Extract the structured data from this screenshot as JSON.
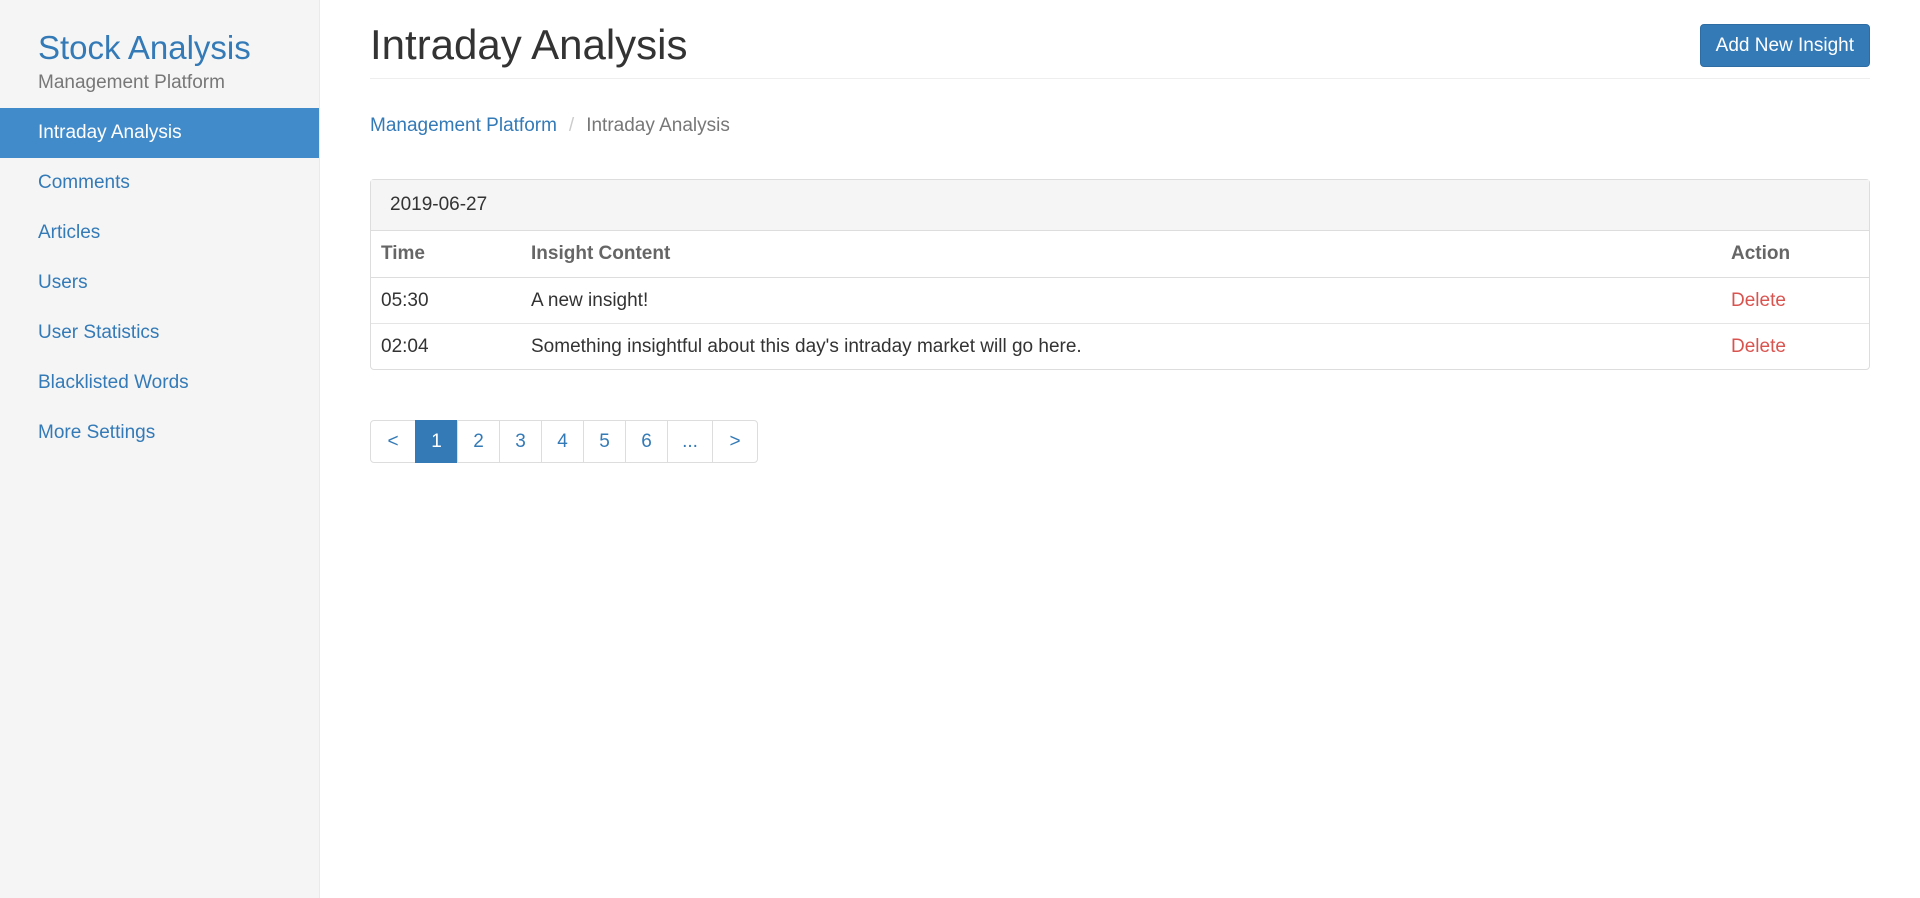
{
  "sidebar": {
    "brand_title": "Stock Analysis",
    "brand_subtitle": "Management Platform",
    "items": [
      {
        "label": "Intraday Analysis",
        "active": true
      },
      {
        "label": "Comments",
        "active": false
      },
      {
        "label": "Articles",
        "active": false
      },
      {
        "label": "Users",
        "active": false
      },
      {
        "label": "User Statistics",
        "active": false
      },
      {
        "label": "Blacklisted Words",
        "active": false
      },
      {
        "label": "More Settings",
        "active": false
      }
    ]
  },
  "header": {
    "title": "Intraday Analysis",
    "add_button_label": "Add New Insight"
  },
  "breadcrumb": {
    "parent": "Management Platform",
    "separator": "/",
    "current": "Intraday Analysis"
  },
  "panel": {
    "date": "2019-06-27",
    "columns": {
      "time": "Time",
      "content": "Insight Content",
      "action": "Action"
    },
    "rows": [
      {
        "time": "05:30",
        "content": "A new insight!",
        "action": "Delete"
      },
      {
        "time": "02:04",
        "content": "Something insightful about this day's intraday market will go here.",
        "action": "Delete"
      }
    ]
  },
  "pagination": {
    "prev": "<",
    "pages": [
      "1",
      "2",
      "3",
      "4",
      "5",
      "6"
    ],
    "current": "1",
    "ellipsis": "...",
    "next": ">"
  },
  "colors": {
    "accent": "#337ab7",
    "active_nav": "#428bca",
    "danger": "#d9534f",
    "sidebar_bg": "#f5f5f5"
  }
}
